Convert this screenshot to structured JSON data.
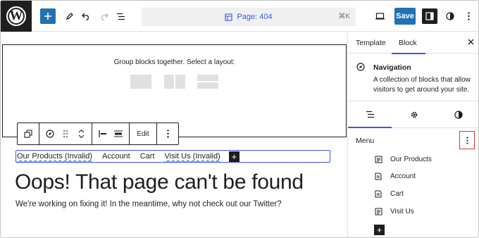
{
  "topbar": {
    "command_label": "Page: 404",
    "shortcut": "⌘K",
    "save_label": "Save",
    "icons": [
      "wordpress-logo",
      "plus-icon",
      "pen-icon",
      "undo-icon",
      "redo-icon",
      "list-view-icon",
      "desktop-icon",
      "settings-icon",
      "styles-icon",
      "more-icon"
    ]
  },
  "canvas": {
    "group_text": "Group blocks together. Select a layout:",
    "toolbar": {
      "edit_label": "Edit"
    },
    "nav_links": [
      {
        "label": "Our Products (Invalid)",
        "invalid": true
      },
      {
        "label": "Account",
        "invalid": false
      },
      {
        "label": "Cart",
        "invalid": false
      },
      {
        "label": "Visit Us (Invalid)",
        "invalid": true
      }
    ],
    "heading": "Oops! That page can't be found",
    "paragraph": "We're working on fixing it! In the meantime, why not check out our Twitter?"
  },
  "sidebar": {
    "tabs": [
      "Template",
      "Block"
    ],
    "active_tab": "Block",
    "block": {
      "title": "Navigation",
      "description": "A collection of blocks that allow visitors to get around your site."
    },
    "menu_label": "Menu",
    "menu_items": [
      "Our Products",
      "Account",
      "Cart",
      "Visit Us"
    ]
  },
  "colors": {
    "accent": "#3858e9",
    "primary_button": "#2271b1",
    "dark": "#1e1e1e",
    "highlight": "#d63638"
  }
}
